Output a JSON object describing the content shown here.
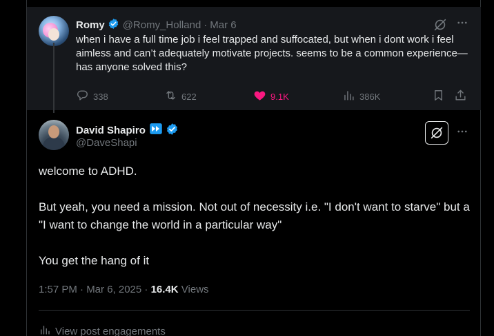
{
  "parent_tweet": {
    "author_name": "Romy",
    "handle": "@Romy_Holland",
    "separator": "·",
    "date": "Mar 6",
    "text": "when i have a full time job i feel trapped and suffocated, but when i dont work i feel aimless and can’t adequately motivate projects. seems to be a common experience—has anyone solved this?",
    "replies": "338",
    "reposts": "622",
    "likes": "9.1K",
    "views": "386K",
    "icons": [
      "verified-badge-icon",
      "grok-icon",
      "more-icon",
      "reply-icon",
      "repost-icon",
      "like-heart-icon",
      "views-chart-icon",
      "bookmark-icon",
      "share-icon"
    ]
  },
  "main_tweet": {
    "author_name": "David Shapiro",
    "handle": "@DaveShapi",
    "paragraphs": [
      "welcome to ADHD.",
      "But yeah, you need a mission. Not out of necessity i.e. \"I don't want to starve\" but a \"I want to change the world in a particular way\"",
      "You get the hang of  it"
    ],
    "timestamp": "1:57 PM · Mar 6, 2025",
    "meta_separator": "·",
    "views_count": "16.4K",
    "views_label": "Views",
    "engagements_link": "View post engagements",
    "icons": [
      "fast-forward-badge-icon",
      "verified-badge-icon",
      "grok-icon",
      "more-icon",
      "engagements-chart-icon"
    ]
  },
  "colors": {
    "background": "#000000",
    "parent_background": "#16181c",
    "text": "#e7e9ea",
    "muted": "#71767b",
    "verified": "#1d9bf0",
    "like": "#f91880",
    "border": "#2f3336"
  }
}
